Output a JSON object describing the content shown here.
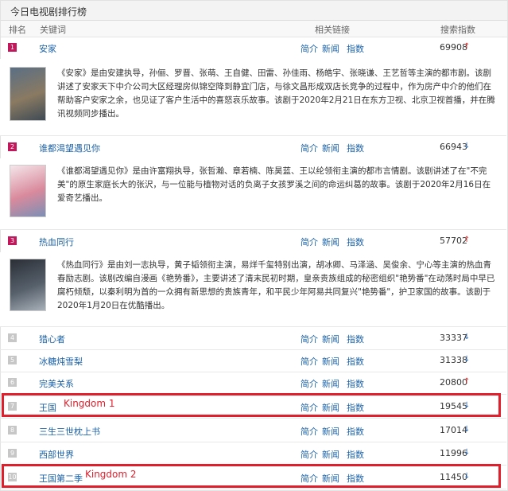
{
  "title": "今日电视剧排行榜",
  "columns": {
    "rank": "排名",
    "keyword": "关键词",
    "links": "相关链接",
    "index": "搜索指数"
  },
  "link_labels": {
    "intro": "简介",
    "news": "新闻",
    "index": "指数"
  },
  "rows": [
    {
      "rank": "1",
      "name": "安家",
      "value": "69908",
      "trend": "up",
      "arrow": "↑",
      "desc": "《安家》是由安建执导，孙俪、罗晋、张萌、王自健、田雷、孙佳雨、杨皓宇、张晓谦、王艺哲等主演的都市剧。该剧讲述了安家天下中介公司大区经理房似锦空降到静宜门店，与徐文昌形成双店长竞争的过程中，作为房产中介的他们在帮助客户安家之余，也见证了客户生活中的喜怒哀乐故事。该剧于2020年2月21日在东方卫视、北京卫视首播，并在腾讯视频同步播出。",
      "poster_colors": [
        "#5a6f84",
        "#8a7a62",
        "#3f4b55"
      ]
    },
    {
      "rank": "2",
      "name": "谁都渴望遇见你",
      "value": "66943",
      "trend": "down",
      "arrow": "↓",
      "desc": "《谁都渴望遇见你》是由许富翔执导，张哲瀚、章若楠、陈昊蓝、王以纶领衔主演的都市言情剧。该剧讲述了在\"不完美\"的原生家庭长大的张沢，与一位能与植物对话的负离子女孩罗溪之间的命运纠葛的故事。该剧于2020年2月16日在爱奇艺播出。",
      "poster_colors": [
        "#f4e6ea",
        "#d98a9c",
        "#7c8fb5"
      ]
    },
    {
      "rank": "3",
      "name": "热血同行",
      "value": "57702",
      "trend": "up",
      "arrow": "↑",
      "desc": "《热血同行》是由刘一志执导，黄子韬领衔主演，易烊千玺特别出演，胡冰卿、马泽涵、吴俊余、宁心等主演的热血青春励志剧。该剧改编自漫画《艳势番》，主要讲述了清末民初时期，皇亲贵族组成的秘密组织\"艳势番\"在动荡时局中早已腐朽倾颓，以秦利明为首的一众拥有新思想的贵族青年，和平民少年阿易共同复兴\"艳势番\"，护卫家国的故事。该剧于2020年1月20日在优酷播出。",
      "poster_colors": [
        "#2b2f36",
        "#56606b",
        "#a8b0b8"
      ]
    },
    {
      "rank": "4",
      "name": "猎心者",
      "value": "33337",
      "trend": "down",
      "arrow": "↓"
    },
    {
      "rank": "5",
      "name": "冰糖炖雪梨",
      "value": "31338",
      "trend": "down",
      "arrow": "↓"
    },
    {
      "rank": "6",
      "name": "完美关系",
      "value": "20800",
      "trend": "up",
      "arrow": "↑"
    },
    {
      "rank": "7",
      "name": "王国",
      "value": "19545",
      "trend": "down",
      "arrow": "↓",
      "annotation": "Kingdom 1"
    },
    {
      "rank": "8",
      "name": "三生三世枕上书",
      "value": "17014",
      "trend": "down",
      "arrow": "↓"
    },
    {
      "rank": "9",
      "name": "西部世界",
      "value": "11996",
      "trend": "down",
      "arrow": "↓"
    },
    {
      "rank": "10",
      "name": "王国第二季",
      "value": "11450",
      "trend": "down",
      "arrow": "↓",
      "annotation": "Kingdom 2"
    }
  ],
  "colors": {
    "top_rank": "#c2185b",
    "other_rank": "#c7c7c7",
    "link": "#1d63a8",
    "up": "#e53935",
    "down": "#3a78c2",
    "highlight": "#e01e2c"
  }
}
